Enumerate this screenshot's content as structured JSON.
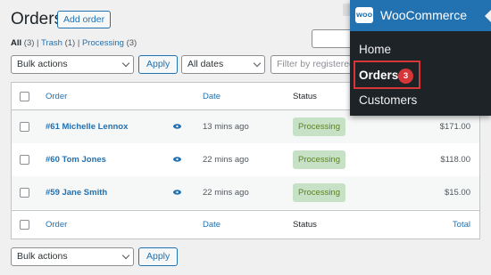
{
  "header": {
    "title": "Orders",
    "add_order_label": "Add order"
  },
  "filters": {
    "all_label": "All",
    "all_count": "(3)",
    "trash_label": "Trash",
    "trash_count": "(1)",
    "processing_label": "Processing",
    "processing_count": "(3)",
    "separator": "|"
  },
  "toolbar": {
    "bulk_actions_value": "Bulk actions",
    "apply_label": "Apply",
    "dates_value": "All dates",
    "filter_placeholder": "Filter by registered c"
  },
  "table": {
    "columns": {
      "order": "Order",
      "date": "Date",
      "status": "Status",
      "total": "Total"
    },
    "rows": [
      {
        "order": "#61 Michelle Lennox",
        "date": "13 mins ago",
        "status": "Processing",
        "total": "$171.00"
      },
      {
        "order": "#60 Tom Jones",
        "date": "22 mins ago",
        "status": "Processing",
        "total": "$118.00"
      },
      {
        "order": "#59 Jane Smith",
        "date": "22 mins ago",
        "status": "Processing",
        "total": "$15.00"
      }
    ]
  },
  "bottom_toolbar": {
    "bulk_actions_value": "Bulk actions",
    "apply_label": "Apply"
  },
  "menu": {
    "logo_text": "WOO",
    "title": "WooCommerce",
    "items": [
      {
        "label": "Home"
      },
      {
        "label": "Orders",
        "count": "3"
      },
      {
        "label": "Customers"
      }
    ]
  },
  "colors": {
    "accent": "#2271b1",
    "sidebar": "#1d2327",
    "badge_red": "#d63638",
    "processing_bg": "#c6e1c6",
    "processing_text": "#5b841b"
  }
}
